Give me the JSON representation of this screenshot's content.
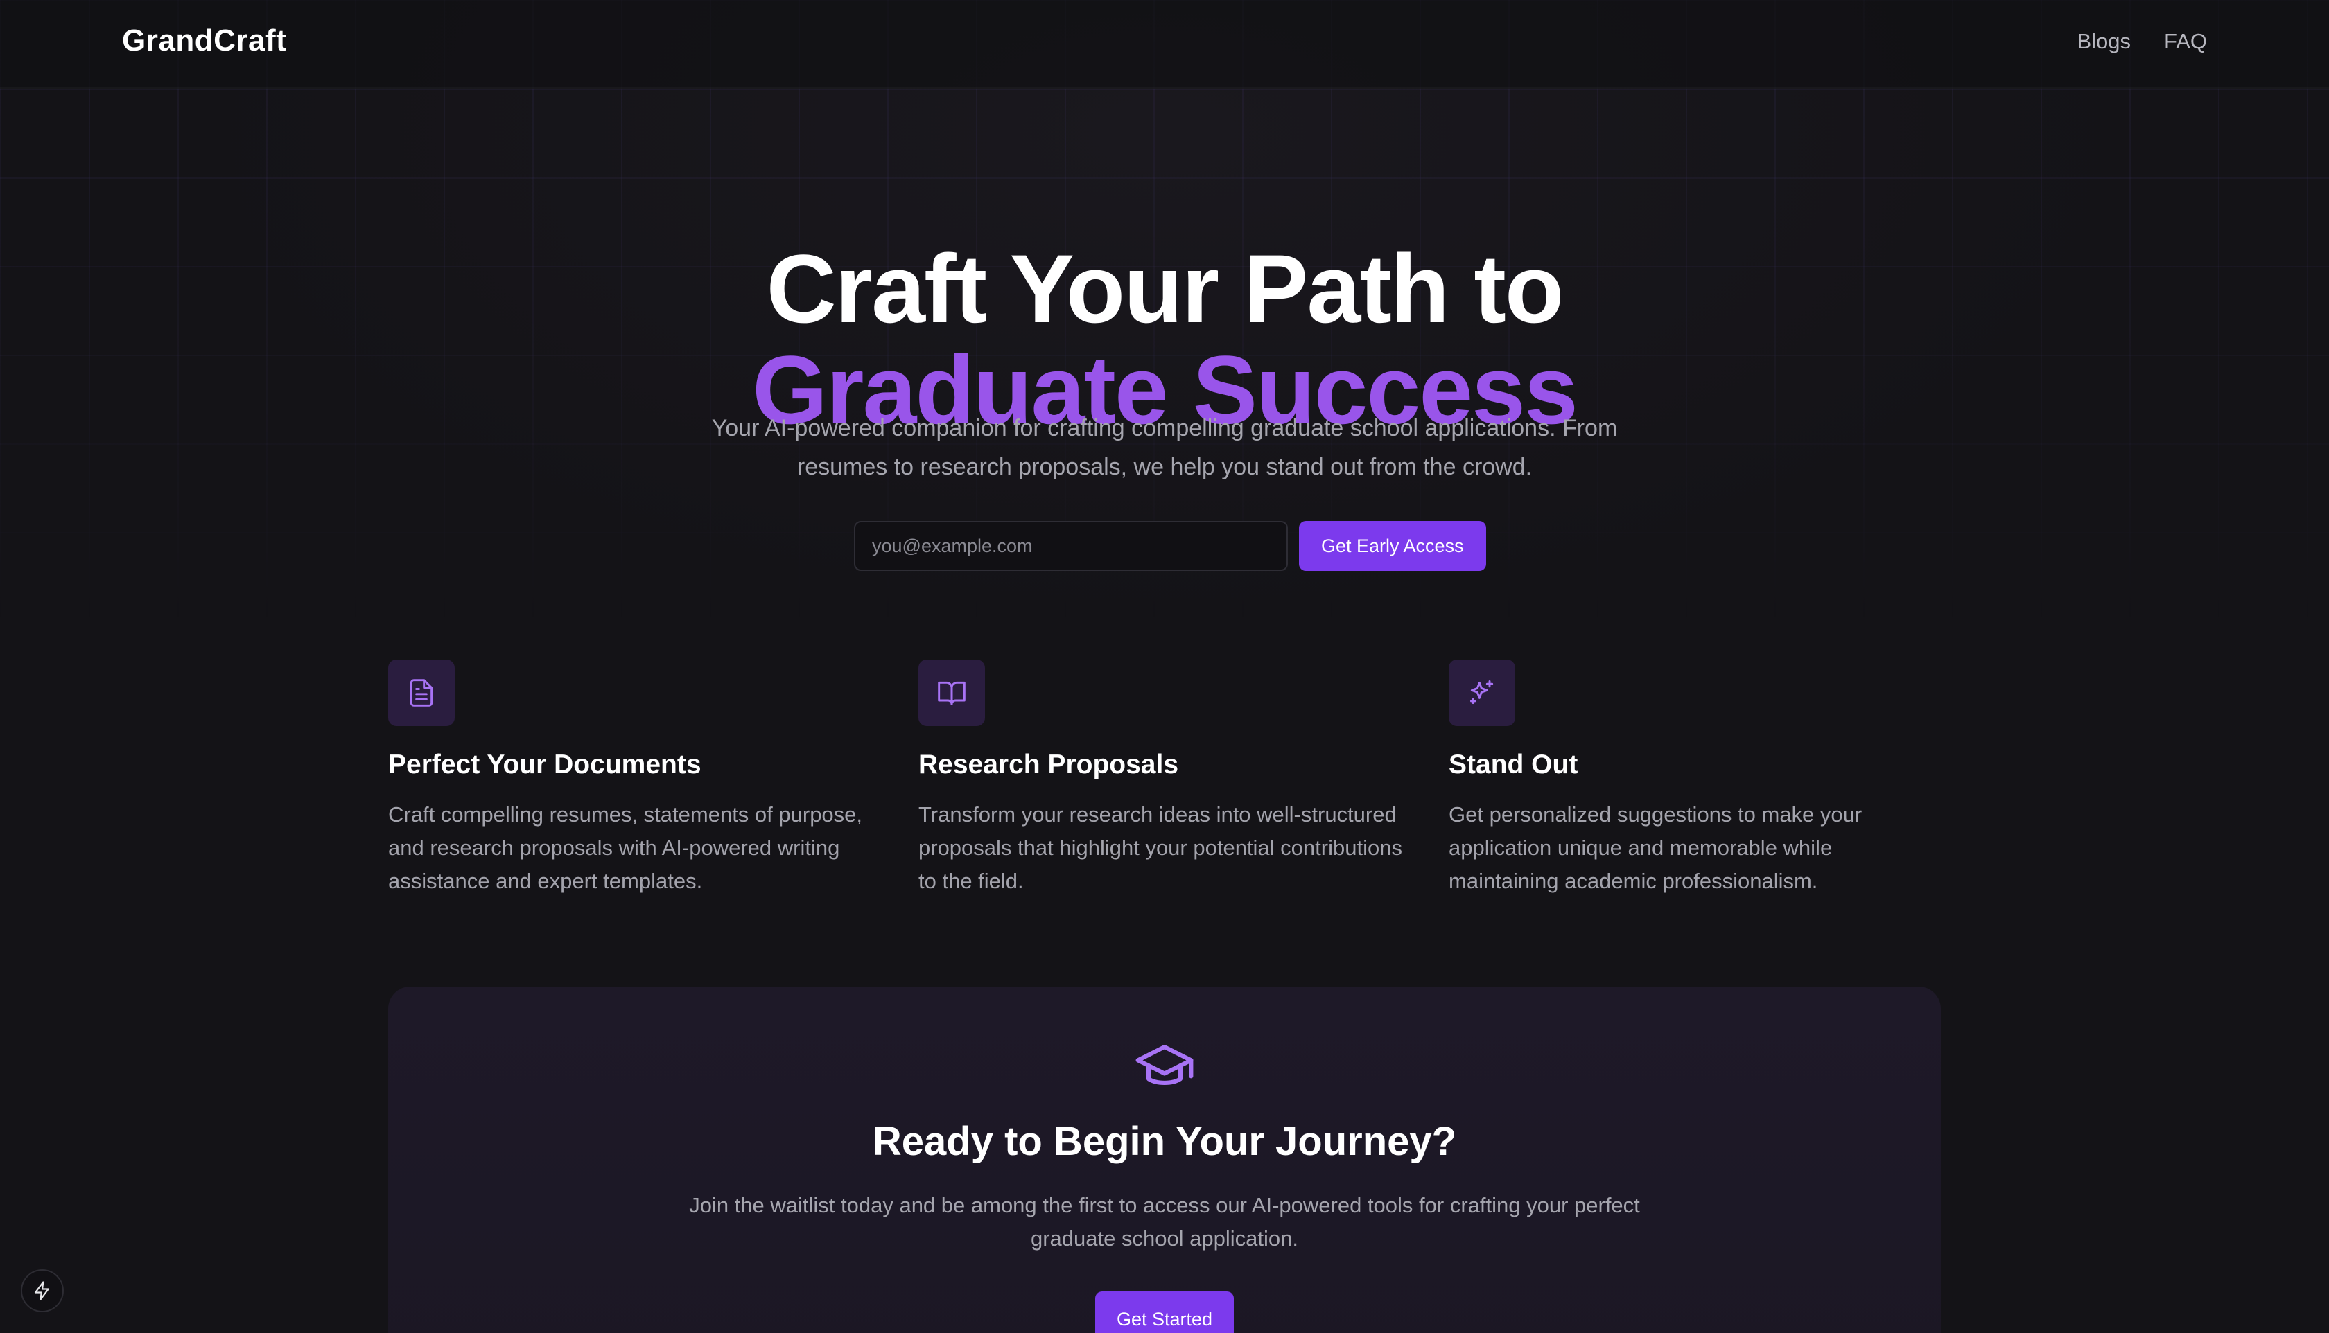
{
  "header": {
    "brand": "GrandCraft",
    "nav": [
      {
        "label": "Blogs"
      },
      {
        "label": "FAQ"
      }
    ]
  },
  "hero": {
    "title_line1": "Craft Your Path to",
    "title_line2": "Graduate Success",
    "subtitle": "Your AI-powered companion for crafting compelling graduate school applications. From resumes to research proposals, we help you stand out from the crowd.",
    "email_placeholder": "you@example.com",
    "cta_label": "Get Early Access"
  },
  "features": [
    {
      "icon": "document-icon",
      "title": "Perfect Your Documents",
      "description": "Craft compelling resumes, statements of purpose, and research proposals with AI-powered writing assistance and expert templates."
    },
    {
      "icon": "book-open-icon",
      "title": "Research Proposals",
      "description": "Transform your research ideas into well-structured proposals that highlight your potential contributions to the field."
    },
    {
      "icon": "sparkles-icon",
      "title": "Stand Out",
      "description": "Get personalized suggestions to make your application unique and memorable while maintaining academic professionalism."
    }
  ],
  "cta_section": {
    "icon": "graduation-cap-icon",
    "title": "Ready to Begin Your Journey?",
    "description": "Join the waitlist today and be among the first to access our AI-powered tools for crafting your perfect graduate school application.",
    "button_label": "Get Started"
  },
  "floating": {
    "icon": "lightning-icon"
  },
  "colors": {
    "background": "#141317",
    "accent": "#7c3aed",
    "accent_text": "#9955ea",
    "icon_tile": "#2a1d3f",
    "muted_text": "#a5a5ae"
  }
}
